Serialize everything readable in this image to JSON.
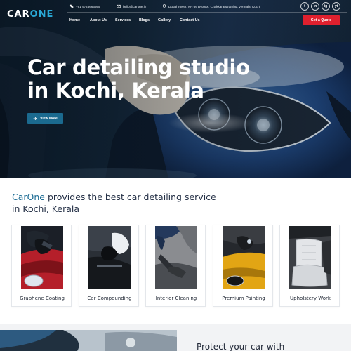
{
  "header": {
    "logo_main": "CAR",
    "logo_accent": "ONE",
    "phone": "+91 9746666565",
    "email": "hello@carone.in",
    "address": "Dubai Tower, NH 66 Bypass, Chakkaraparambu, Vennala, Kochi",
    "social": [
      "f",
      "in",
      "ig",
      "yt"
    ]
  },
  "nav": {
    "items": [
      "Home",
      "About Us",
      "Services",
      "Blogs",
      "Gallery",
      "Contact Us"
    ],
    "quote_label": "Get a Quote"
  },
  "hero": {
    "title_line1": "Car detailing studio",
    "title_line2": "in Kochi, Kerala",
    "cta_label": "View More"
  },
  "intro": {
    "brand": "CarOne",
    "text": " provides the best car detailing service in Kochi, Kerala"
  },
  "services": [
    {
      "label": "Graphene Coating"
    },
    {
      "label": "Car Compounding"
    },
    {
      "label": "Interior Cleaning"
    },
    {
      "label": "Premium Painting"
    },
    {
      "label": "Upholstery Work"
    }
  ],
  "bottom": {
    "heading": "Protect your car with"
  },
  "colors": {
    "accent": "#2aa9d6",
    "brand_text": "#1c6c94",
    "quote_button": "#e0202e",
    "cta_button": "#1b6a8f"
  }
}
